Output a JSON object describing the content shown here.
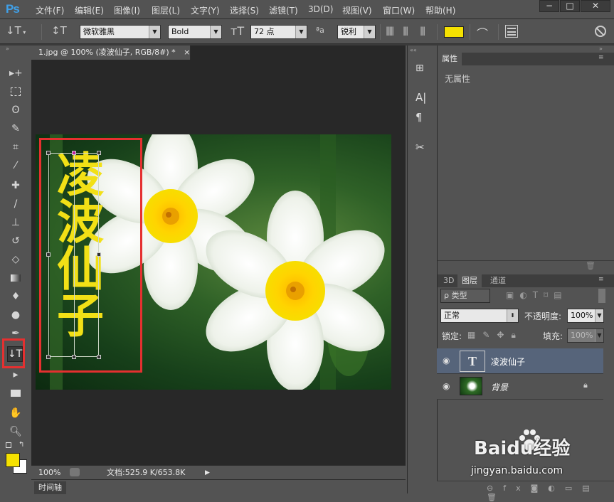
{
  "app": {
    "logo": "Ps"
  },
  "menu": [
    "文件(F)",
    "编辑(E)",
    "图像(I)",
    "图层(L)",
    "文字(Y)",
    "选择(S)",
    "滤镜(T)",
    "3D(D)",
    "视图(V)",
    "窗口(W)",
    "帮助(H)"
  ],
  "window_controls": {
    "minimize": "−",
    "restore": "□",
    "close": "✕"
  },
  "options": {
    "font_family": "微软雅黑",
    "font_style": "Bold",
    "font_size": "72 点",
    "aa_label": "ªa",
    "aa_mode": "锐利",
    "text_color": "#f5e100"
  },
  "document": {
    "tab_title": "1.jpg @ 100% (凌波仙子, RGB/8#) *",
    "tab_close": "×",
    "text_layer_content": "凌波仙子",
    "text_color": "#f2e016"
  },
  "status": {
    "zoom": "100%",
    "doc_info": "文档:525.9 K/653.8K"
  },
  "timeline": {
    "label": "时间轴"
  },
  "properties": {
    "tab": "属性",
    "content": "无属性"
  },
  "layers_panel": {
    "tabs": [
      "3D",
      "图层",
      "通道"
    ],
    "filter_label": "ρ 类型",
    "blend_mode": "正常",
    "opacity_label": "不透明度:",
    "opacity_value": "100%",
    "lock_label": "锁定:",
    "fill_label": "填充:",
    "fill_value": "100%",
    "layers": [
      {
        "name": "凌波仙子",
        "type": "text",
        "selected": true
      },
      {
        "name": "背景",
        "type": "image",
        "locked": true
      }
    ]
  },
  "colors": {
    "foreground": "#f5e100",
    "background": "#ffffff",
    "highlight_box": "#e53030",
    "panel": "#535353",
    "doc_bg": "#282828"
  },
  "watermark": {
    "brand": "Baidu经验",
    "url": "jingyan.baidu.com"
  }
}
